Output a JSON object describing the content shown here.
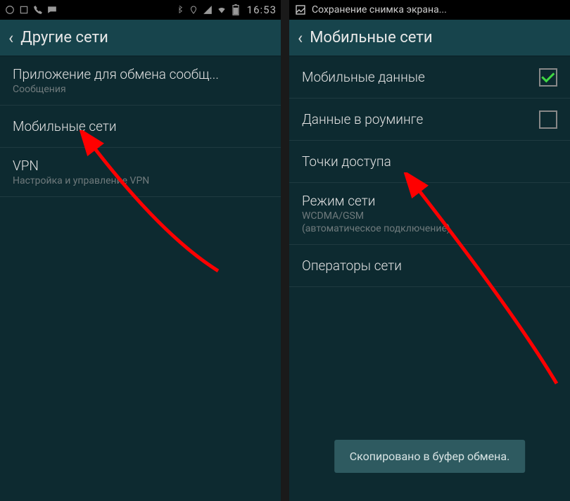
{
  "left": {
    "status": {
      "time": "16:53"
    },
    "header": {
      "title": "Другие сети"
    },
    "rows": [
      {
        "title": "Приложение для обмена сообщ...",
        "sub": "Сообщения"
      },
      {
        "title": "Мобильные сети"
      },
      {
        "title": "VPN",
        "sub": "Настройка и управление VPN"
      }
    ]
  },
  "right": {
    "notif": {
      "text": "Сохранение снимка экрана..."
    },
    "header": {
      "title": "Мобильные сети"
    },
    "rows": [
      {
        "title": "Мобильные данные",
        "checkbox": true,
        "checked": true
      },
      {
        "title": "Данные в роуминге",
        "checkbox": true,
        "checked": false
      },
      {
        "title": "Точки доступа"
      },
      {
        "title": "Режим сети",
        "sub": "WCDMA/GSM",
        "sub2": "(автоматическое подключение)"
      },
      {
        "title": "Операторы сети"
      }
    ],
    "toast": "Скопировано в буфер обмена."
  }
}
